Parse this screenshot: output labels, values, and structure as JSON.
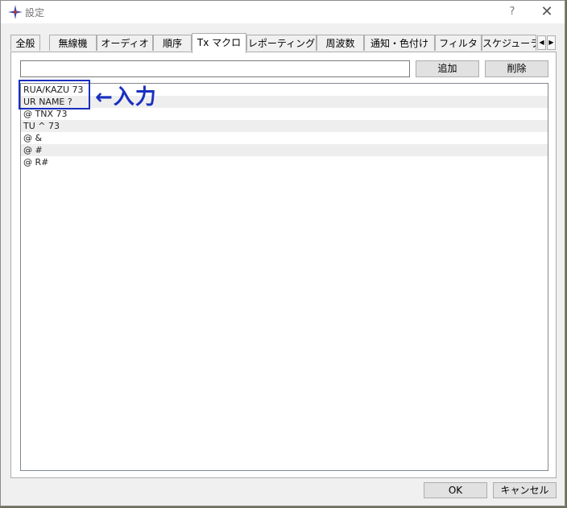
{
  "window": {
    "title": "設定",
    "help": "?",
    "close": "✕"
  },
  "tabs": [
    {
      "label": "全般"
    },
    {
      "label": "無線機"
    },
    {
      "label": "オーディオ"
    },
    {
      "label": "順序"
    },
    {
      "label": "Tx マクロ",
      "active": true
    },
    {
      "label": "レポーティング"
    },
    {
      "label": "周波数"
    },
    {
      "label": "通知・色付け"
    },
    {
      "label": "フィルタ"
    },
    {
      "label": "スケジューラ"
    }
  ],
  "macro": {
    "input_value": "",
    "add_label": "追加",
    "delete_label": "削除",
    "items": [
      "RUA/KAZU 73",
      "UR NAME ?",
      "@ TNX 73",
      "TU ^ 73",
      "@ &",
      "@ #",
      "@ R#"
    ]
  },
  "annotation": {
    "text": "←入力",
    "color": "#1a2fc0"
  },
  "footer": {
    "ok_label": "OK",
    "cancel_label": "キャンセル"
  },
  "colors": {
    "accent": "#1a2fc0"
  }
}
